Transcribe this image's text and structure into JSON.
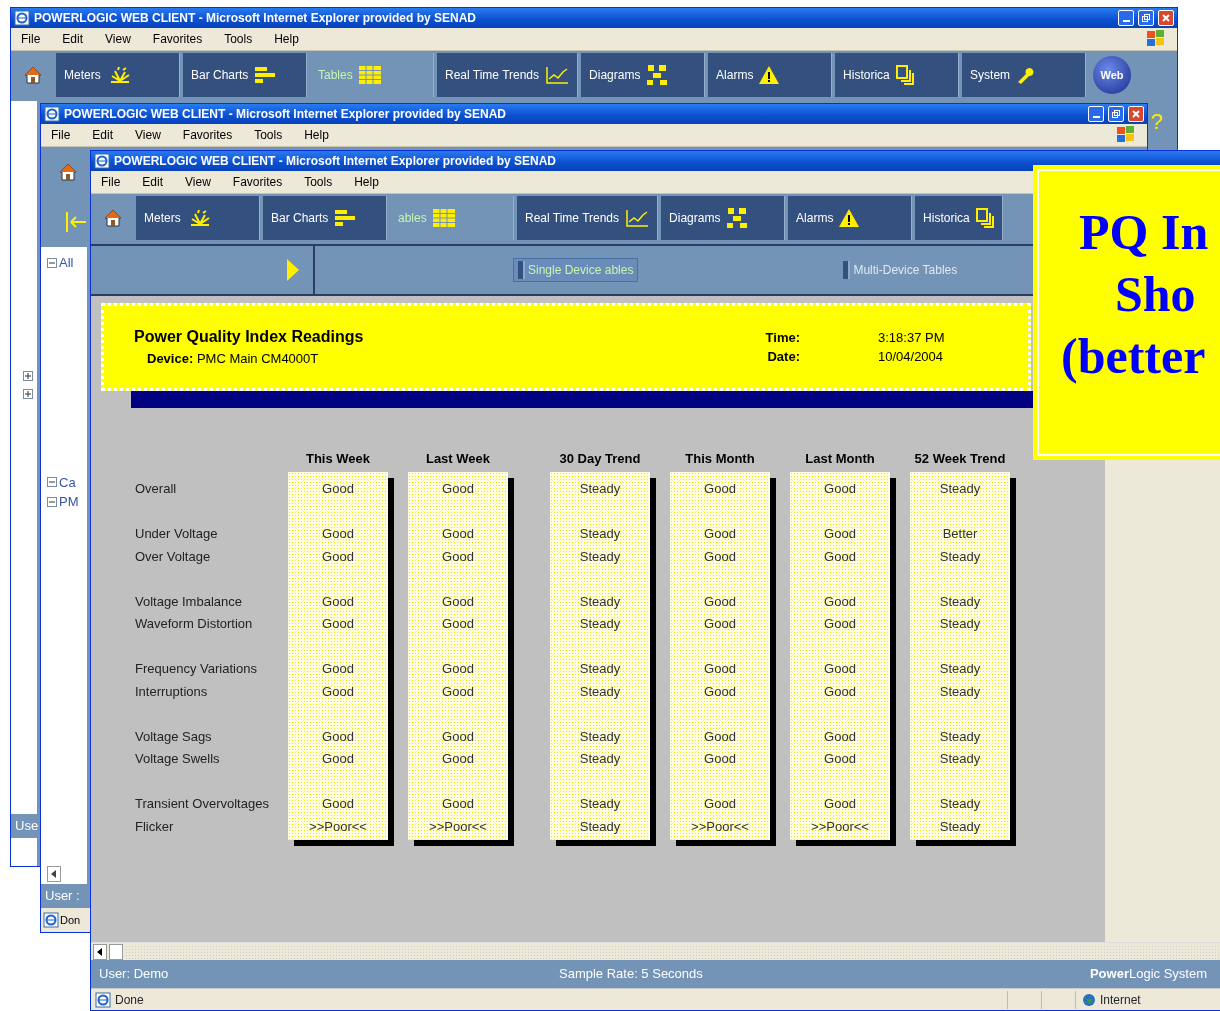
{
  "back_window": {
    "title": "POWERLOGIC WEB CLIENT - Microsoft Internet Explorer provided by SENAD",
    "menu": [
      "File",
      "Edit",
      "View",
      "Favorites",
      "Tools",
      "Help"
    ],
    "nav_tabs": [
      {
        "label": "Meters",
        "selected": false
      },
      {
        "label": "Bar Charts",
        "selected": false
      },
      {
        "label": "Tables",
        "selected": true
      },
      {
        "label": "Real Time Trends",
        "selected": false
      },
      {
        "label": "Diagrams",
        "selected": false
      },
      {
        "label": "Alarms",
        "selected": false
      },
      {
        "label": "Historica",
        "selected": false
      },
      {
        "label": "System",
        "selected": false
      }
    ],
    "logo_text": "Web",
    "help": "?",
    "tree": [
      {
        "expanded": false
      },
      {
        "expanded": false
      }
    ],
    "status_user": "Use"
  },
  "middle_window": {
    "title": "POWERLOGIC WEB CLIENT - Microsoft Internet Explorer provided by SENAD",
    "menu": [
      "File",
      "Edit",
      "View",
      "Favorites",
      "Tools",
      "Help"
    ],
    "tree": [
      {
        "label": "All",
        "expanded": true
      },
      {
        "label": "Ca",
        "expanded": true
      },
      {
        "label": "PM",
        "expanded": true
      }
    ],
    "status_user": "User :",
    "ie_status": "Don"
  },
  "front_window": {
    "title": "POWERLOGIC WEB CLIENT - Microsoft Internet Explorer provided by SENAD",
    "menu": [
      "File",
      "Edit",
      "View",
      "Favorites",
      "Tools",
      "Help"
    ],
    "nav_tabs": [
      {
        "label": "Meters",
        "selected": false
      },
      {
        "label": "Bar Charts",
        "selected": false
      },
      {
        "label": "ables",
        "selected": true
      },
      {
        "label": "Real Time Trends",
        "selected": false
      },
      {
        "label": "Diagrams",
        "selected": false
      },
      {
        "label": "Alarms",
        "selected": false
      },
      {
        "label": "Historica",
        "selected": false
      }
    ],
    "sub_tabs": [
      {
        "label": "Single Device ables",
        "selected": true
      },
      {
        "label": "Multi-Device Tables",
        "selected": false
      }
    ],
    "report": {
      "title": "Power Quality Index Readings",
      "device_label": "Device:",
      "device": "PMC Main CM4000T",
      "time_label": "Time:",
      "time": "3:18:37 PM",
      "date_label": "Date:",
      "date": "10/04/2004",
      "columns": [
        "This Week",
        "Last Week",
        "30 Day Trend",
        "This Month",
        "Last Month",
        "52 Week Trend"
      ],
      "groups": [
        [
          {
            "label": "Overall",
            "values": [
              "Good",
              "Good",
              "Steady",
              "Good",
              "Good",
              "Steady"
            ]
          }
        ],
        [
          {
            "label": "Under Voltage",
            "values": [
              "Good",
              "Good",
              "Steady",
              "Good",
              "Good",
              "Better"
            ]
          },
          {
            "label": "Over Voltage",
            "values": [
              "Good",
              "Good",
              "Steady",
              "Good",
              "Good",
              "Steady"
            ]
          }
        ],
        [
          {
            "label": "Voltage Imbalance",
            "values": [
              "Good",
              "Good",
              "Steady",
              "Good",
              "Good",
              "Steady"
            ]
          },
          {
            "label": "Waveform Distortion",
            "values": [
              "Good",
              "Good",
              "Steady",
              "Good",
              "Good",
              "Steady"
            ]
          }
        ],
        [
          {
            "label": "Frequency Variations",
            "values": [
              "Good",
              "Good",
              "Steady",
              "Good",
              "Good",
              "Steady"
            ]
          },
          {
            "label": "Interruptions",
            "values": [
              "Good",
              "Good",
              "Steady",
              "Good",
              "Good",
              "Steady"
            ]
          }
        ],
        [
          {
            "label": "Voltage Sags",
            "values": [
              "Good",
              "Good",
              "Steady",
              "Good",
              "Good",
              "Steady"
            ]
          },
          {
            "label": "Voltage Swells",
            "values": [
              "Good",
              "Good",
              "Steady",
              "Good",
              "Good",
              "Steady"
            ]
          }
        ],
        [
          {
            "label": "Transient Overvoltages",
            "values": [
              "Good",
              "Good",
              "Steady",
              "Good",
              "Good",
              "Steady"
            ]
          },
          {
            "label": "Flicker",
            "values": [
              ">>Poor<<",
              ">>Poor<<",
              "Steady",
              ">>Poor<<",
              ">>Poor<<",
              "Steady"
            ]
          }
        ]
      ]
    },
    "status_bar": {
      "user": "User: Demo",
      "sample_rate": "Sample Rate: 5 Seconds",
      "brand": "**Power**Logic System"
    },
    "ie_status": {
      "text": "Done",
      "zone": "Internet"
    }
  },
  "callout": {
    "lines": [
      "PQ In",
      "Sho",
      "(better"
    ]
  }
}
